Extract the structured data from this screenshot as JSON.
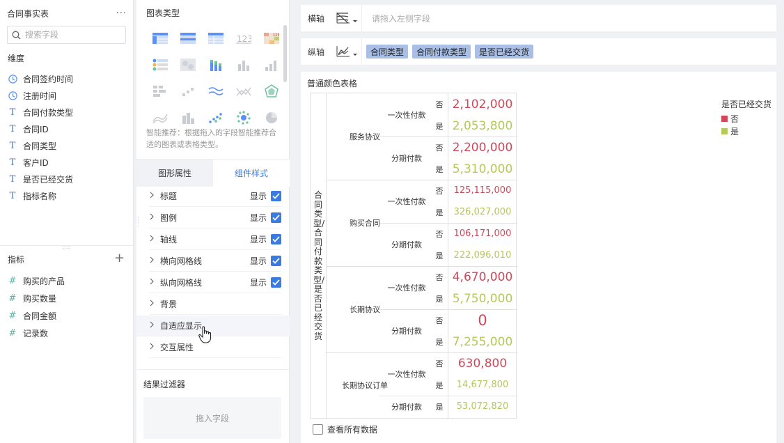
{
  "left": {
    "dataset_title": "合同事实表",
    "more_icon": "···",
    "search_placeholder": "搜索字段",
    "dimension_label": "维度",
    "dimensions": [
      {
        "icon": "clock-icon",
        "label": "合同签约时间"
      },
      {
        "icon": "clock-icon",
        "label": "注册时间"
      },
      {
        "icon": "text-type-icon",
        "label": "合同付款类型"
      },
      {
        "icon": "text-type-icon",
        "label": "合同ID"
      },
      {
        "icon": "text-type-icon",
        "label": "合同类型"
      },
      {
        "icon": "text-type-icon",
        "label": "客户ID"
      },
      {
        "icon": "text-type-icon",
        "label": "是否已经交货"
      },
      {
        "icon": "text-type-icon",
        "label": "指标名称"
      }
    ],
    "measure_label": "指标",
    "add_icon": "+",
    "measures": [
      {
        "icon": "number-type-icon",
        "label": "购买的产品"
      },
      {
        "icon": "number-type-icon",
        "label": "购买数量"
      },
      {
        "icon": "number-type-icon",
        "label": "合同金额"
      },
      {
        "icon": "number-type-icon",
        "label": "记录数"
      }
    ]
  },
  "middle": {
    "chart_type_title": "图表类型",
    "smart_recommend": "智能推荐：根据拖入的字段智能推荐合适的图表或表格类型。",
    "tabs": [
      "图形属性",
      "组件样式"
    ],
    "active_tab": 1,
    "props": [
      {
        "label": "标题",
        "show": "显示",
        "checked": true
      },
      {
        "label": "图例",
        "show": "显示",
        "checked": true
      },
      {
        "label": "轴线",
        "show": "显示",
        "checked": true
      },
      {
        "label": "横向网格线",
        "show": "显示",
        "checked": true
      },
      {
        "label": "纵向网格线",
        "show": "显示",
        "checked": true
      },
      {
        "label": "背景",
        "show": "",
        "checked": false
      },
      {
        "label": "自适应显示",
        "show": "",
        "checked": false
      },
      {
        "label": "交互属性",
        "show": "",
        "checked": false
      }
    ],
    "filter_title": "结果过滤器",
    "filter_drop": "拖入字段"
  },
  "axes": {
    "x_label": "横轴",
    "x_placeholder": "请拖入左侧字段",
    "y_label": "纵轴",
    "y_fields": [
      "合同类型",
      "合同付款类型",
      "是否已经交货"
    ]
  },
  "table": {
    "title": "普通颜色表格",
    "row_header_vertical": "合同类型/合同付款类型/是否已经交货",
    "groups": [
      {
        "name": "服务协议",
        "pay": [
          {
            "name": "一次性付款",
            "rows": [
              {
                "d": "否",
                "v": "2,102,000"
              },
              {
                "d": "是",
                "v": "2,053,800"
              }
            ]
          },
          {
            "name": "分期付款",
            "rows": [
              {
                "d": "否",
                "v": "2,200,000"
              },
              {
                "d": "是",
                "v": "5,310,000"
              }
            ]
          }
        ]
      },
      {
        "name": "购买合同",
        "pay": [
          {
            "name": "一次性付款",
            "rows": [
              {
                "d": "否",
                "v": "125,115,000"
              },
              {
                "d": "是",
                "v": "326,027,000"
              }
            ]
          },
          {
            "name": "分期付款",
            "rows": [
              {
                "d": "否",
                "v": "106,171,000"
              },
              {
                "d": "是",
                "v": "222,096,010"
              }
            ]
          }
        ]
      },
      {
        "name": "长期协议",
        "pay": [
          {
            "name": "一次性付款",
            "rows": [
              {
                "d": "否",
                "v": "4,670,000"
              },
              {
                "d": "是",
                "v": "5,750,000"
              }
            ]
          },
          {
            "name": "分期付款",
            "rows": [
              {
                "d": "否",
                "v": "0"
              },
              {
                "d": "是",
                "v": "7,255,000"
              }
            ]
          }
        ]
      },
      {
        "name": "长期协议订单",
        "pay": [
          {
            "name": "一次性付款",
            "rows": [
              {
                "d": "否",
                "v": "630,800"
              },
              {
                "d": "是",
                "v": "14,677,800"
              }
            ]
          },
          {
            "name": "分期付款",
            "rows": [
              {
                "d": "是",
                "v": "53,072,820"
              }
            ]
          }
        ]
      }
    ],
    "legend_title": "是否已经交货",
    "legend": [
      {
        "label": "否",
        "color": "#d0485a"
      },
      {
        "label": "是",
        "color": "#b3c959"
      }
    ],
    "view_all": "查看所有数据"
  },
  "colors": {
    "accent": "#3a7be0",
    "pill": "#a9bfe6",
    "no": "#d0485a",
    "yes": "#b3c959"
  }
}
